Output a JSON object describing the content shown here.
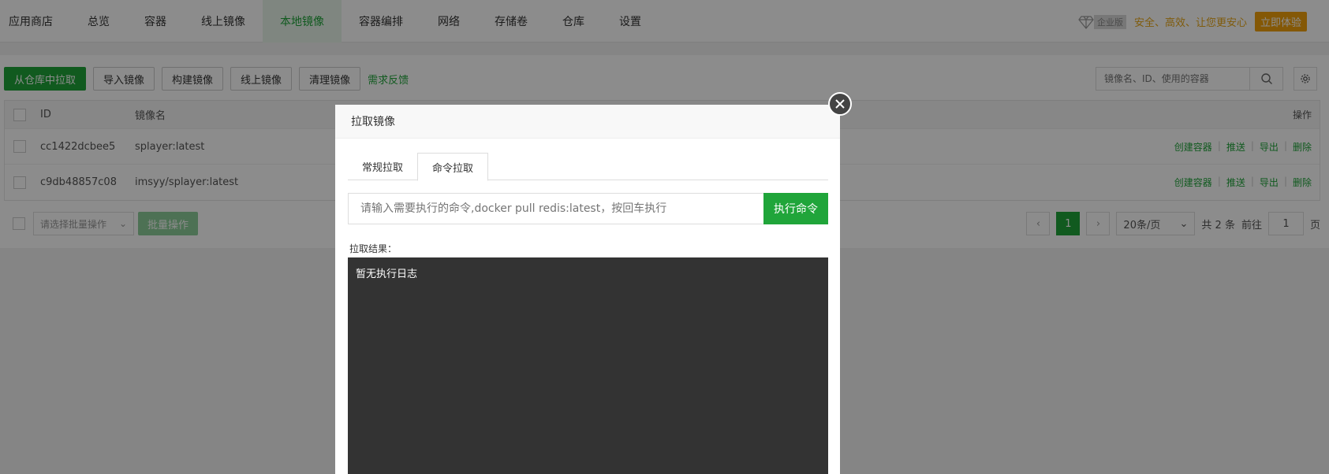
{
  "nav": {
    "tabs": [
      "应用商店",
      "总览",
      "容器",
      "线上镜像",
      "本地镜像",
      "容器编排",
      "网络",
      "存储卷",
      "仓库",
      "设置"
    ],
    "active_tab": "本地镜像",
    "enterprise_label": "企业版",
    "slogan": "安全、高效、让您更安心",
    "try_button": "立即体验"
  },
  "toolbar": {
    "pull_from_repo": "从仓库中拉取",
    "import_image": "导入镜像",
    "build_image": "构建镜像",
    "online_image": "线上镜像",
    "clean_image": "清理镜像",
    "feedback": "需求反馈",
    "search_placeholder": "镜像名、ID、使用的容器"
  },
  "table": {
    "headers": {
      "id": "ID",
      "name": "镜像名",
      "ops": "操作"
    },
    "rows": [
      {
        "id": "cc1422dcbee5",
        "name": "splayer:latest"
      },
      {
        "id": "c9db48857c08",
        "name": "imsyy/splayer:latest"
      }
    ],
    "row_ops": [
      "创建容器",
      "推送",
      "导出",
      "删除"
    ]
  },
  "bulk": {
    "select_placeholder": "请选择批量操作",
    "button": "批量操作"
  },
  "pager": {
    "current": "1",
    "page_size": "20条/页",
    "total": "共 2 条",
    "goto_label": "前往",
    "goto_value": "1",
    "page_unit": "页"
  },
  "modal": {
    "title": "拉取镜像",
    "tabs": [
      "常规拉取",
      "命令拉取"
    ],
    "active_tab": "命令拉取",
    "cmd_placeholder": "请输入需要执行的命令,docker pull redis:latest，按回车执行",
    "exec_button": "执行命令",
    "result_label": "拉取结果：",
    "console_text": "暂无执行日志"
  },
  "colors": {
    "accent": "#20a53a",
    "warning": "#f0a00c",
    "console_bg": "#333333"
  }
}
